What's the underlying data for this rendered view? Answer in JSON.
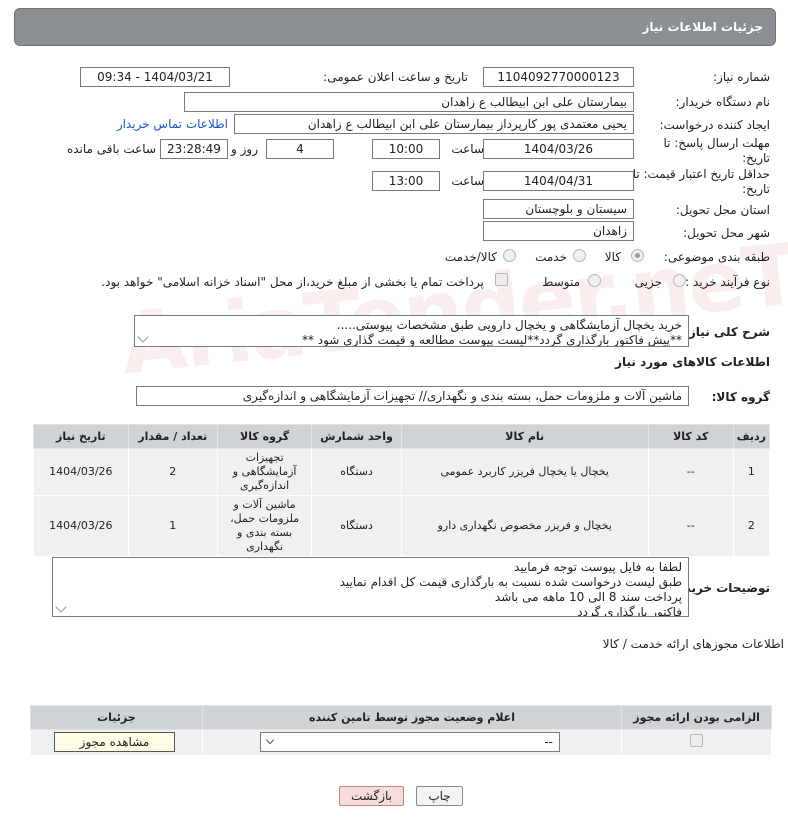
{
  "header": {
    "title": "جزئیات اطلاعات نیاز"
  },
  "fields": {
    "need_number_label": "شماره نیاز:",
    "need_number": "1104092770000123",
    "announce_label": "تاریخ و ساعت اعلان عمومی:",
    "announce_value": "1404/03/21 - 09:34",
    "buyer_org_label": "نام دستگاه خریدار:",
    "buyer_org": "بیمارستان علی ابن ابیطالب  ع  زاهدان",
    "requester_label": "ایجاد کننده درخواست:",
    "requester": "یحیی معتمدی پور کارپرداز بیمارستان علی ابن ابیطالب  ع  زاهدان",
    "contact_link": "اطلاعات تماس خریدار",
    "deadline_label": "مهلت ارسال پاسخ: تا تاریخ:",
    "deadline_date": "1404/03/26",
    "time_label": "ساعت",
    "deadline_time": "10:00",
    "days_value": "4",
    "days_label": "روز و",
    "remaining_time": "23:28:49",
    "remaining_label": "ساعت باقی مانده",
    "price_validity_label": "حداقل تاریخ اعتبار قیمت: تا تاریخ:",
    "price_validity_date": "1404/04/31",
    "price_validity_time": "13:00",
    "province_label": "استان محل تحویل:",
    "province": "سیستان و بلوچستان",
    "city_label": "شهر محل تحویل:",
    "city": "زاهدان",
    "category_label": "طبقه بندی موضوعی:",
    "category_options": [
      "کالا",
      "خدمت",
      "کالا/خدمت"
    ],
    "process_label": "نوع فرآیند خرید :",
    "process_options": [
      "جزیی",
      "متوسط"
    ],
    "payment_note": "پرداخت تمام یا بخشی از مبلغ خرید،از محل \"اسناد خزانه اسلامی\" خواهد بود."
  },
  "description": {
    "label": "شرح کلی نیاز:",
    "line1": "خرید یخچال آزمایشگاهی و یخچال دارویی طبق مشخصات پیوستی.....",
    "line2": "**پیش فاکتور بارگذاری گردد**لیست پیوست مطالعه و قیمت گذاری شود **"
  },
  "goods_section": {
    "title": "اطلاعات کالاهای مورد نیاز",
    "group_label": "گروه کالا:",
    "group_value": "ماشین آلات و ملزومات حمل، بسته بندی و نگهداری// تجهیزات آزمایشگاهی و اندازه‌گیری"
  },
  "goods_table": {
    "headers": [
      "ردیف",
      "کد کالا",
      "نام کالا",
      "واحد شمارش",
      "گروه کالا",
      "تعداد / مقدار",
      "تاریخ نیاز"
    ],
    "rows": [
      [
        "1",
        "--",
        "یخچال یا یخچال فریزر کاربرد عمومی",
        "دستگاه",
        "تجهیزات آزمایشگاهی و اندازه‌گیری",
        "2",
        "1404/03/26"
      ],
      [
        "2",
        "--",
        "یخچال و فریزر مخصوص نگهداری دارو",
        "دستگاه",
        "ماشین آلات و ملزومات حمل، بسته بندی و نگهداری",
        "1",
        "1404/03/26"
      ]
    ]
  },
  "buyer_notes": {
    "label": "توضیحات خریدار:",
    "lines": [
      "لطفا به فایل پیوست توجه فرمایید",
      "طبق لیست درخواست شده نسبت به بارگذاری قیمت کل اقدام نمایید",
      "پرداخت سند 8 الی 10 ماهه می باشد",
      "فاکتور بارگذاری گردد"
    ]
  },
  "permits": {
    "title": "اطلاعات مجوزهای ارائه خدمت / کالا",
    "headers": [
      "الزامی بودن ارائه مجوز",
      "اعلام وضعیت مجوز توسط تامین کننده",
      "جزئیات"
    ],
    "select_value": "--",
    "view_button": "مشاهده مجوز"
  },
  "footer": {
    "print_button": "چاپ",
    "back_button": "بازگشت"
  },
  "watermark": "AriaTender.neT"
}
